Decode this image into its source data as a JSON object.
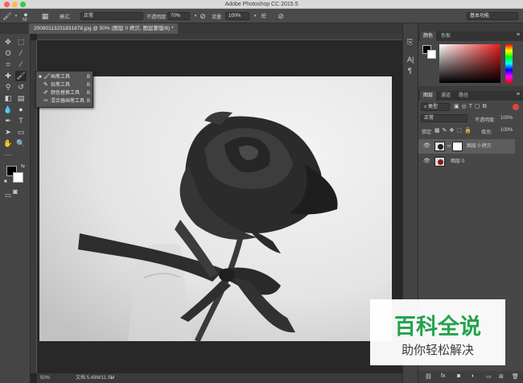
{
  "window": {
    "title": "Adobe Photoshop CC 2015.5"
  },
  "options": {
    "brush_size": "50",
    "mode_label": "模式:",
    "mode_value": "正常",
    "opacity_label": "不透明度:",
    "opacity_value": "70%",
    "flow_label": "流量:",
    "flow_value": "100%",
    "workspace": "基本功能"
  },
  "document": {
    "tab_label": "200801132318318​78.jpg @ 50% (图层 0 拷贝, 图层蒙版/8) *"
  },
  "flyout": {
    "items": [
      {
        "label": "画笔工具",
        "key": "B",
        "icon": "brush-icon",
        "checked": true
      },
      {
        "label": "铅笔工具",
        "key": "B",
        "icon": "pencil-icon",
        "checked": false
      },
      {
        "label": "颜色替换工具",
        "key": "B",
        "icon": "color-replace-icon",
        "checked": false
      },
      {
        "label": "混合器画笔工具",
        "key": "B",
        "icon": "mixer-brush-icon",
        "checked": false
      }
    ]
  },
  "status": {
    "zoom": "50%",
    "doc_info": "文档:5.49M/11.0M"
  },
  "color_panel": {
    "tabs": [
      "颜色",
      "色板"
    ]
  },
  "layers_panel": {
    "tabs": [
      "图层",
      "通道",
      "路径"
    ],
    "filter_label": "类型",
    "blend_mode": "正常",
    "opacity_label": "不透明度:",
    "opacity_value": "100%",
    "lock_label": "锁定:",
    "fill_label": "填充:",
    "fill_value": "100%",
    "layers": [
      {
        "name": "图层 0 拷贝",
        "selected": true
      },
      {
        "name": "图层 0",
        "selected": false
      }
    ],
    "footer_fx": "fx"
  },
  "watermark": {
    "title": "百科全说",
    "subtitle": "助你轻松解决"
  },
  "colors": {
    "accent_green": "#23a34d",
    "panel_bg": "#3c3c3c",
    "toolbar_bg": "#454545"
  }
}
